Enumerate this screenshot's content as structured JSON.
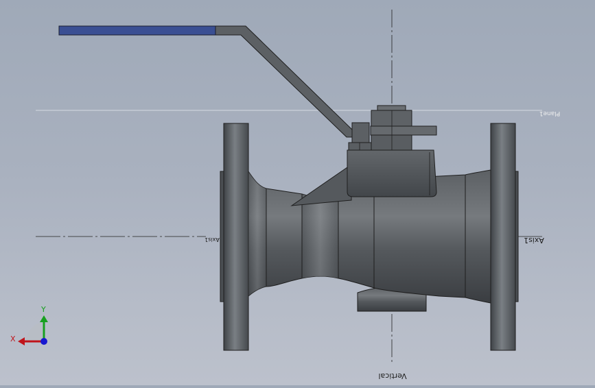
{
  "viewport": {
    "model": "ball-valve",
    "handle_color": "#3a4f93",
    "body_color": "#4f5357",
    "background_top": "#9fa9b8",
    "background_bottom": "#bcc1cc"
  },
  "reference_labels": {
    "vertical": "Vertical",
    "axis_right": "Axis1",
    "axis_left": "Axis1",
    "plane": "Plane1"
  },
  "triad": {
    "x_label": "X",
    "y_label": "Y",
    "x_color": "#c0141b",
    "y_color": "#17a01f",
    "z_color": "#1818d0"
  }
}
